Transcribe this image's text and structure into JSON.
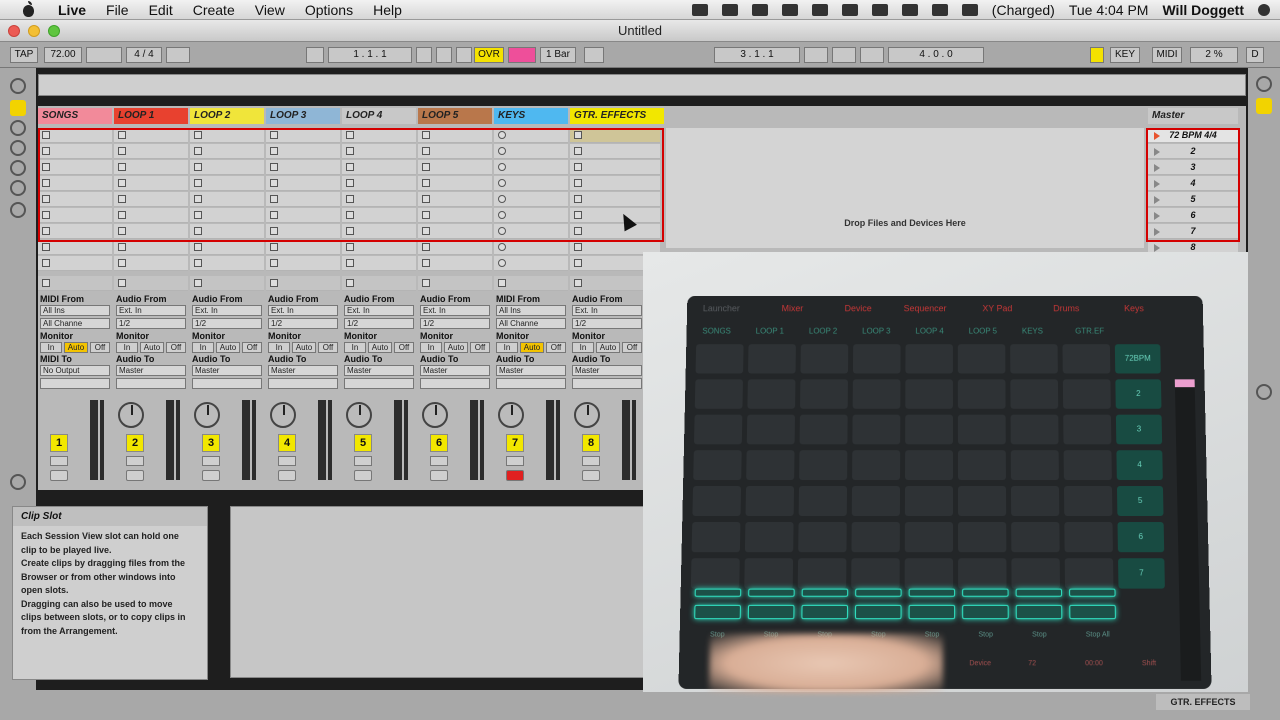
{
  "menubar": {
    "app": "Live",
    "items": [
      "File",
      "Edit",
      "Create",
      "View",
      "Options",
      "Help"
    ],
    "battery": "(Charged)",
    "clock": "Tue 4:04 PM",
    "user": "Will Doggett"
  },
  "window": {
    "title": "Untitled"
  },
  "transport": {
    "tap": "TAP",
    "tempo": "72.00",
    "signature": "4 / 4",
    "position": "1 .  1 .  1",
    "ovr": "OVR",
    "quantize": "1 Bar",
    "loop_start": "3 .  1 .  1",
    "loop_len": "4 .  0 .  0",
    "key": "KEY",
    "midi": "MIDI",
    "cpu": "2 %",
    "d": "D"
  },
  "tracks": [
    {
      "name": "SONGS",
      "color": "#f28a9a",
      "num": "1"
    },
    {
      "name": "LOOP 1",
      "color": "#e8412f",
      "num": "2"
    },
    {
      "name": "LOOP 2",
      "color": "#f0e53a",
      "num": "3"
    },
    {
      "name": "LOOP 3",
      "color": "#8fb6d6",
      "num": "4"
    },
    {
      "name": "LOOP 4",
      "color": "#c8c8c8",
      "num": "5"
    },
    {
      "name": "LOOP 5",
      "color": "#b9774b",
      "num": "6"
    },
    {
      "name": "KEYS",
      "color": "#4fb8f0",
      "num": "7"
    },
    {
      "name": "GTR. EFFECTS",
      "color": "#f2e700",
      "num": "8"
    }
  ],
  "master": {
    "name": "Master",
    "scenes": [
      "72 BPM 4/4",
      "2",
      "3",
      "4",
      "5",
      "6",
      "7",
      "8"
    ]
  },
  "dropzone": "Drop Files and Devices Here",
  "io": {
    "midi_from": "MIDI From",
    "audio_from": "Audio From",
    "all_ins": "All Ins",
    "ext_in": "Ext. In",
    "all_channels": "All Channe",
    "half": "1/2",
    "monitor": "Monitor",
    "in": "In",
    "auto": "Auto",
    "off": "Off",
    "midi_to": "MIDI To",
    "audio_to": "Audio To",
    "no_output": "No Output",
    "master": "Master"
  },
  "info": {
    "title": "Clip Slot",
    "body_lines": [
      "Each Session View slot can hold one",
      "clip to be played live.",
      "Create clips by dragging files from the",
      "Browser or from other windows into",
      "open slots.",
      "Dragging can also be used to move",
      "clips between slots, or to copy clips in",
      "from the Arrangement."
    ]
  },
  "status": {
    "track": "GTR. EFFECTS"
  },
  "tablet": {
    "menu": [
      "Launcher",
      "Mixer",
      "Device",
      "Sequencer",
      "XY Pad",
      "Drums",
      "Keys"
    ],
    "tracks": [
      "SONGS",
      "LOOP 1",
      "LOOP 2",
      "LOOP 3",
      "LOOP 4",
      "LOOP 5",
      "KEYS",
      "GTR.EF"
    ],
    "scenes": [
      "72BPM",
      "2",
      "3",
      "4",
      "5",
      "6",
      "7"
    ],
    "stop_labels": [
      "Stop",
      "Stop",
      "Stop",
      "Stop",
      "Stop",
      "Stop",
      "Stop",
      "Stop All"
    ],
    "bottom_labels": [
      "Device",
      "72",
      "00:00",
      "Shift"
    ]
  }
}
